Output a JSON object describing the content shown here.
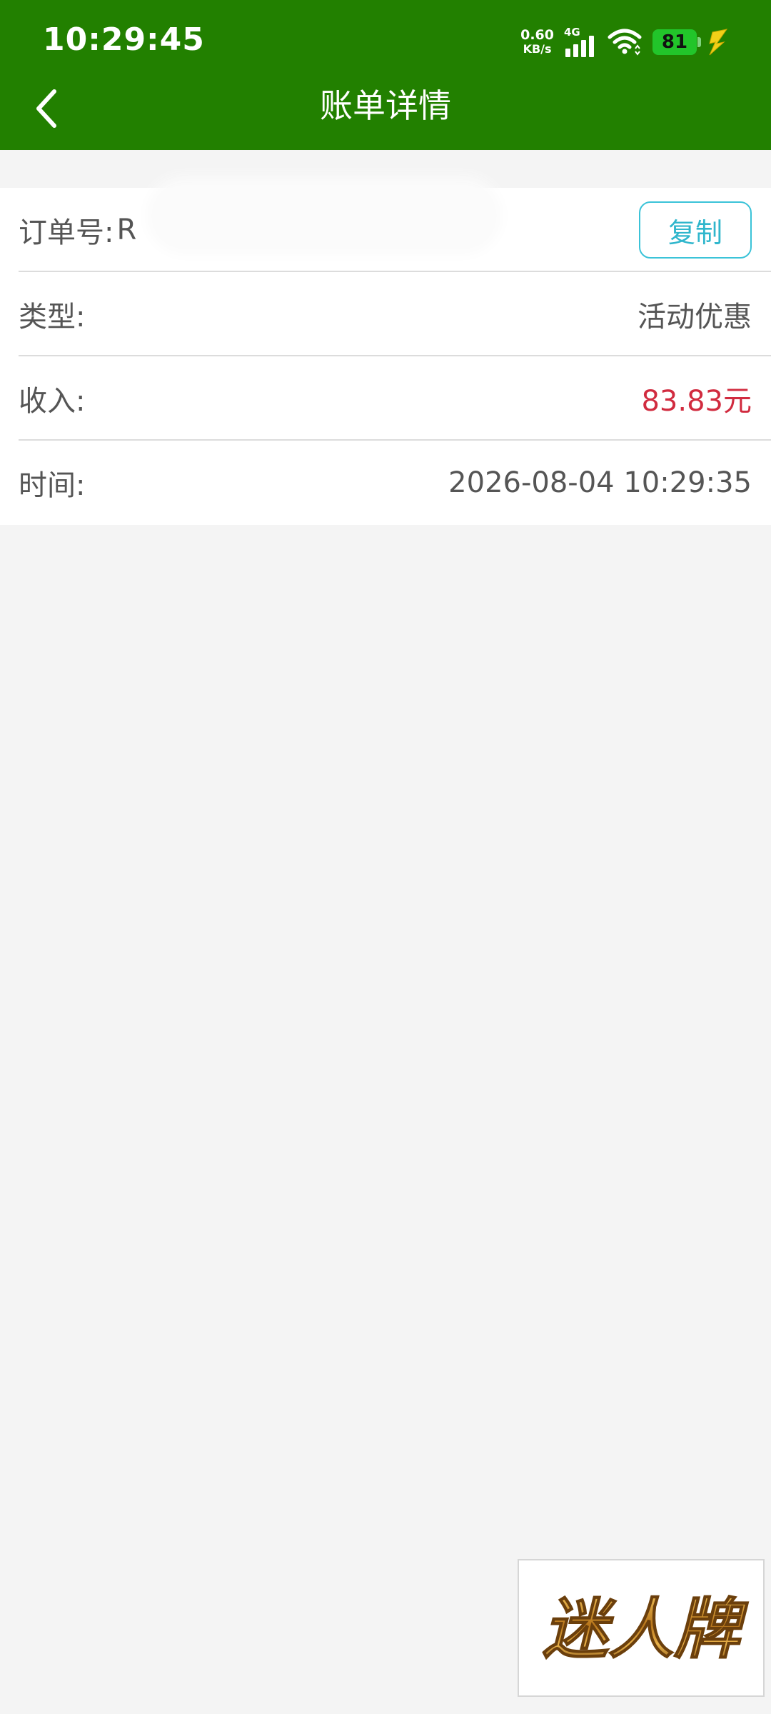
{
  "status_bar": {
    "time": "10:29:45",
    "net_speed_value": "0.60",
    "net_speed_unit": "KB/s",
    "network_type": "4G",
    "battery_level": "81",
    "icons": [
      "signal-icon",
      "wifi-icon",
      "battery-icon",
      "charging-bolt-icon"
    ]
  },
  "header": {
    "title": "账单详情",
    "back_icon": "chevron-left-icon"
  },
  "details": {
    "order": {
      "label": "订单号:",
      "value": "R",
      "copy_label": "复制"
    },
    "type": {
      "label": "类型:",
      "value": "活动优惠"
    },
    "income": {
      "label": "收入:",
      "value": "83.83元"
    },
    "time": {
      "label": "时间:",
      "value": "2026-08-04 10:29:35"
    }
  },
  "brand": {
    "text": "迷人牌"
  },
  "colors": {
    "header_bg": "#228000",
    "page_bg": "#f4f4f4",
    "income_red": "#d12b3f",
    "copy_accent": "#3bc3d8"
  }
}
